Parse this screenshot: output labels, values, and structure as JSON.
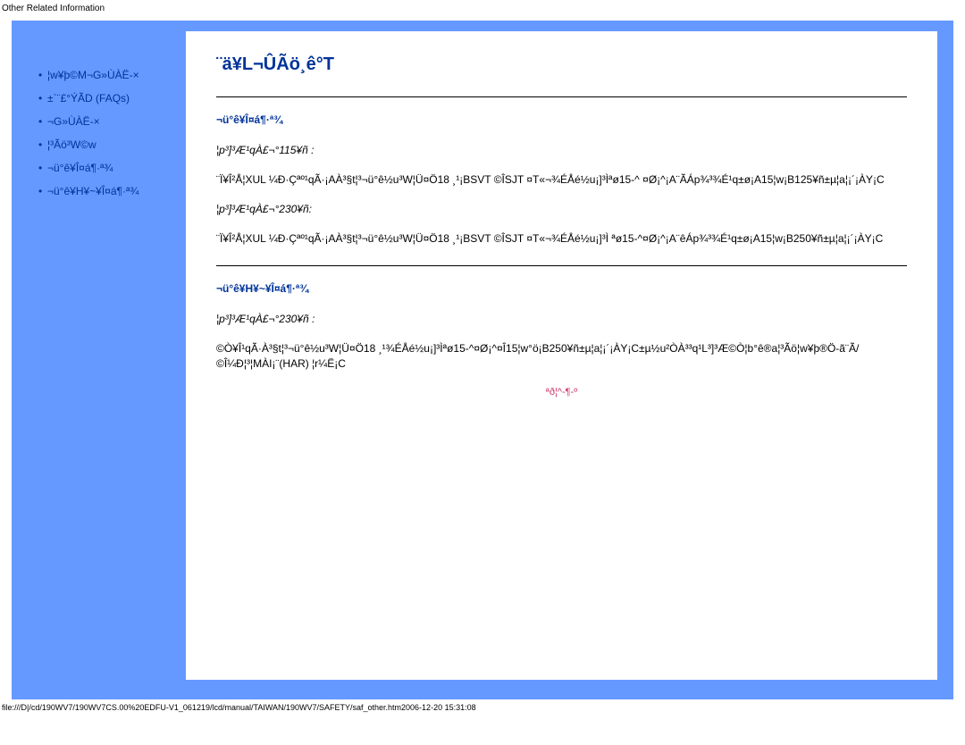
{
  "page_title_top": "Other Related Information",
  "sidebar": {
    "items": [
      {
        "label": "¦w¥þ©M¬G»ÙÀË-×"
      },
      {
        "label": "±`¨£°ÝÃD (FAQs)"
      },
      {
        "label": "¬G»ÙÀË-×"
      },
      {
        "label": "¦³Ãö³W©w"
      },
      {
        "label": "¬ü°ê¥Î¤á¶·ª¾"
      },
      {
        "label": "¬ü°ê¥H¥~¥Î¤á¶·ª¾"
      }
    ]
  },
  "content": {
    "h1": "¨ä¥L¬ÛÃö¸ê°T",
    "sec1": {
      "title": "¬ü°ê¥Î¤á¶·ª¾",
      "sub1": "¦p³]³Æ¹qÀ£¬°115¥ñ :",
      "body1": "¨Ï¥Î²Å¦XUL ¼Ð·Çªº¹qÃ·¡AÀ³§t¦³¬ü°ê½u³W¦Ü¤Ö18 ¸¹¡BSVT ©ÎSJT ¤T«¬¾ÉÅé½u¡]³Ìªø15-^ ¤Ø¡^¡A¨ÃÁp¾³¾É¹q±ø¡A15¦w¡B125¥ñ±µ¦a¦¡´¡ÀY¡C",
      "sub2": "¦p³]³Æ¹qÀ£¬°230¥ñ:",
      "body2": "¨Ï¥Î²Å¦XUL ¼Ð·Çªº¹qÃ·¡AÀ³§t¦³¬ü°ê½u³W¦Ü¤Ö18 ¸¹¡BSVT ©ÎSJT ¤T«¬¾ÉÅé½u¡]³Ì ªø15-^¤Ø¡^¡A¨êÁp¾³¾É¹q±ø¡A15¦w¡B250¥ñ±µ¦a¦¡´¡ÀY¡C"
    },
    "sec2": {
      "title": "¬ü°ê¥H¥~¥Î¤á¶·ª¾",
      "sub1": "¦p³]³Æ¹qÀ£¬°230¥ñ :",
      "body1": "©Ò¥Î¹qÃ·À³§t¦³¬ü°ê½u³W¦Ü¤Ö18 ¸¹¾ÉÅé½u¡]³Ìªø15-^¤Ø¡^¤Î15¦w°ö¡B250¥ñ±µ¦a¦¡´¡ÀY¡C±µ½u²ÒÀ³³q¹L³]³Æ©Ò¦b°ê®a¦³Ãö¦w¥þ®Ö-ã¨Ã/©Î¼Ð¦³¦MÀI¡¨(HAR) ¦r¼Ë¡C"
    },
    "toplink": "ªð¦^-¶-º"
  },
  "footer_path": "file:///D|/cd/190WV7/190WV7CS.00%20EDFU-V1_061219/lcd/manual/TAIWAN/190WV7/SAFETY/saf_other.htm2006-12-20 15:31:08"
}
